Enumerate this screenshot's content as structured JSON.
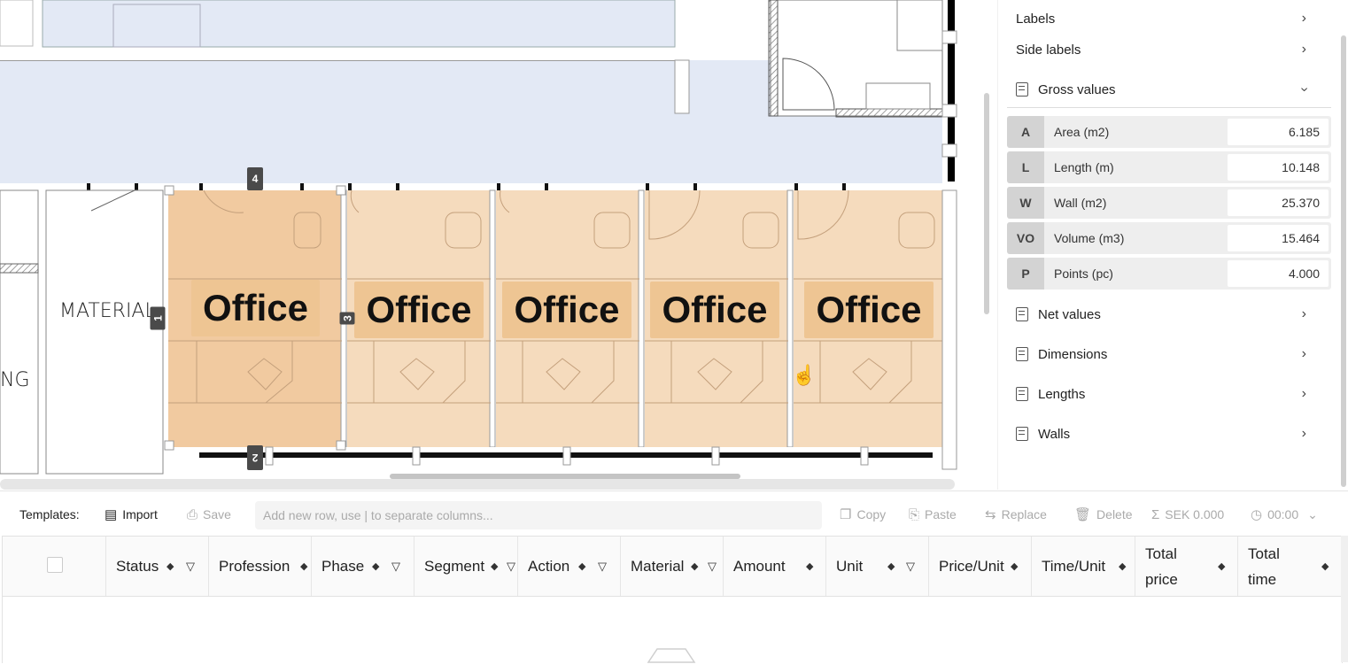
{
  "canvas": {
    "rooms": [
      {
        "label": "Office"
      },
      {
        "label": "Office"
      },
      {
        "label": "Office"
      },
      {
        "label": "Office"
      },
      {
        "label": "Office"
      }
    ],
    "side_rooms": {
      "material": "MATERIAL",
      "partial": "NG"
    },
    "tags": {
      "top": "4",
      "left": "1",
      "mid": "3",
      "bottom": "2"
    }
  },
  "panel": {
    "labels": "Labels",
    "side_labels": "Side labels",
    "gross_values": {
      "title": "Gross values",
      "rows": [
        {
          "abbr": "A",
          "label": "Area (m2)",
          "value": "6.185"
        },
        {
          "abbr": "L",
          "label": "Length (m)",
          "value": "10.148"
        },
        {
          "abbr": "W",
          "label": "Wall (m2)",
          "value": "25.370"
        },
        {
          "abbr": "VO",
          "label": "Volume (m3)",
          "value": "15.464"
        },
        {
          "abbr": "P",
          "label": "Points (pc)",
          "value": "4.000"
        }
      ]
    },
    "net_values": "Net values",
    "dimensions": "Dimensions",
    "lengths": "Lengths",
    "walls": "Walls"
  },
  "toolbar": {
    "templates_label": "Templates:",
    "import": "Import",
    "save": "Save",
    "input_placeholder": "Add new row, use | to separate columns...",
    "copy": "Copy",
    "paste": "Paste",
    "replace": "Replace",
    "delete": "Delete",
    "sum": "SEK 0.000",
    "time": "00:00"
  },
  "table": {
    "columns": [
      {
        "label": "Status"
      },
      {
        "label": "Profession"
      },
      {
        "label": "Phase"
      },
      {
        "label": "Segment"
      },
      {
        "label": "Action"
      },
      {
        "label": "Material"
      },
      {
        "label": "Amount"
      },
      {
        "label": "Unit"
      },
      {
        "label": "Price/Unit"
      },
      {
        "label": "Time/Unit"
      },
      {
        "label": "Total price",
        "line1": "Total",
        "line2": "price"
      },
      {
        "label": "Total time",
        "line1": "Total",
        "line2": "time"
      }
    ]
  }
}
